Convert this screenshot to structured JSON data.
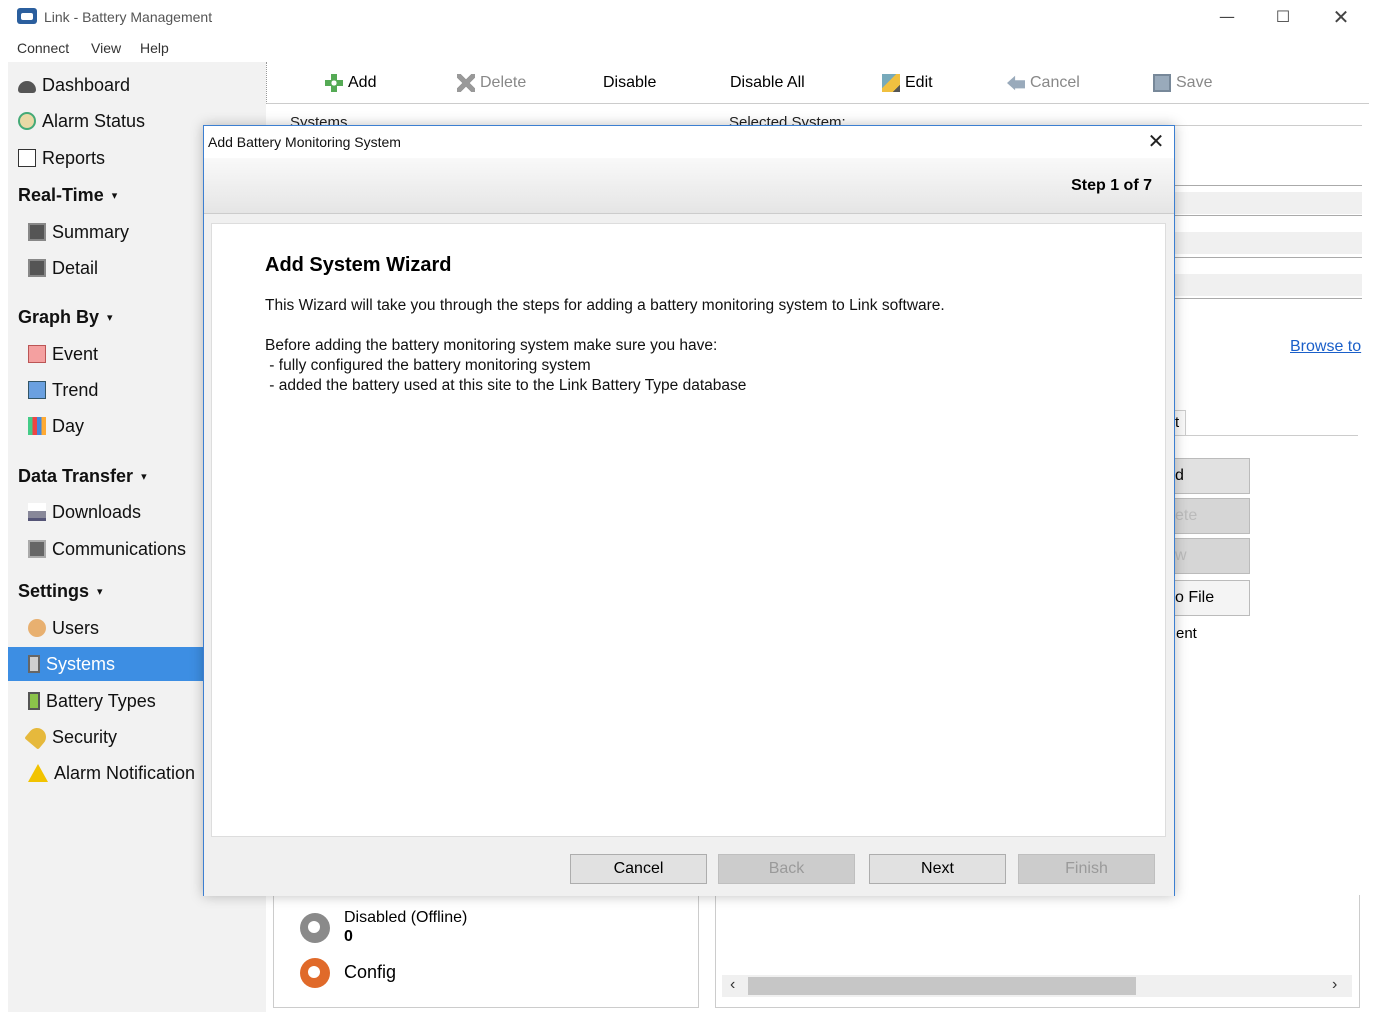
{
  "window": {
    "title": "Link - Battery Management",
    "controls": {
      "minimize": "—",
      "maximize": "☐",
      "close": "✕"
    }
  },
  "menubar": [
    "Connect",
    "View",
    "Help"
  ],
  "sidebar": {
    "dashboard": "Dashboard",
    "alarm_status": "Alarm Status",
    "reports": "Reports",
    "realtime": {
      "header": "Real-Time",
      "items": [
        "Summary",
        "Detail"
      ]
    },
    "graph_by": {
      "header": "Graph By",
      "items": [
        "Event",
        "Trend",
        "Day"
      ]
    },
    "data_transfer": {
      "header": "Data Transfer",
      "items": [
        "Downloads",
        "Communications"
      ]
    },
    "settings": {
      "header": "Settings",
      "items": [
        "Users",
        "Systems",
        "Battery Types",
        "Security",
        "Alarm Notification"
      ]
    },
    "active_item": "Systems",
    "caret": "▾"
  },
  "toolbar": {
    "add": "Add",
    "delete": "Delete",
    "disable": "Disable",
    "disable_all": "Disable All",
    "edit": "Edit",
    "cancel": "Cancel",
    "save": "Save"
  },
  "background": {
    "systems_label": "Systems",
    "selected_system_label": "Selected System:",
    "browse_link": "Browse to",
    "tab_peek": "t",
    "right_buttons": [
      "d",
      "ete",
      "w",
      "o File"
    ],
    "peek_text": "ent",
    "status": {
      "disabled_label": "Disabled (Offline)",
      "disabled_count": "0",
      "config_label": "Config"
    },
    "scroll_left": "‹",
    "scroll_right": "›"
  },
  "dialog": {
    "title": "Add Battery Monitoring System",
    "close": "✕",
    "step": "Step 1 of 7",
    "heading": "Add System Wizard",
    "intro": "This Wizard will take you through the steps for adding a battery monitoring system to Link software.",
    "before": "Before adding the battery monitoring system make sure you have:",
    "bullets": [
      " - fully configured the battery monitoring system",
      " - added the battery used at this site to the Link Battery Type database"
    ],
    "buttons": {
      "cancel": "Cancel",
      "back": "Back",
      "next": "Next",
      "finish": "Finish"
    }
  },
  "colors": {
    "accent": "#3d8ee3",
    "dialog_border": "#3c7fd1",
    "link": "#1a5fc9"
  }
}
